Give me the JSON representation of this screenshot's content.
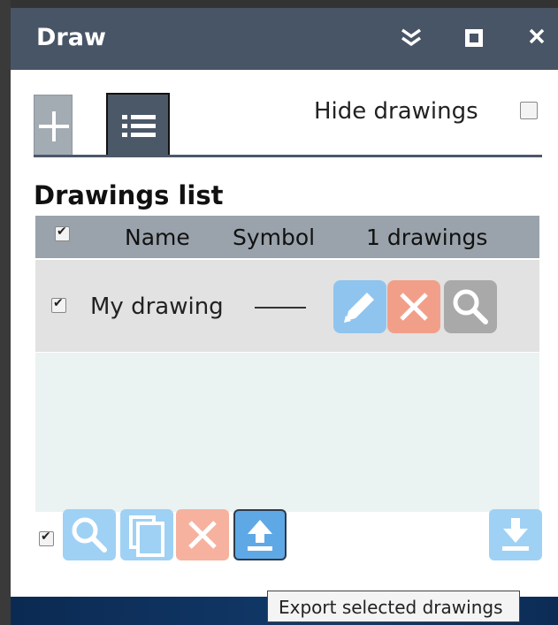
{
  "window": {
    "title": "Draw",
    "controls": {
      "collapse": "collapse-icon",
      "maximize": "maximize-icon",
      "close": "close-icon"
    }
  },
  "tabs": [
    {
      "name": "add-drawing",
      "icon": "plus-icon",
      "active": false
    },
    {
      "name": "drawings-list",
      "icon": "list-icon",
      "active": true
    }
  ],
  "hide_drawings": {
    "label": "Hide drawings",
    "checked": false
  },
  "list": {
    "title": "Drawings list",
    "columns": {
      "name": "Name",
      "symbol": "Symbol",
      "count": "1 drawings"
    },
    "rows": [
      {
        "checked": true,
        "name": "My drawing",
        "symbol": "line"
      }
    ]
  },
  "footer": {
    "select_all_checked": true,
    "buttons": [
      "zoom-icon",
      "copy-icon",
      "delete-icon",
      "export-icon",
      "import-icon"
    ]
  },
  "tooltip": {
    "text": "Export selected drawings"
  },
  "colors": {
    "titlebar": "#485566",
    "edit": "#8fc4ef",
    "delete": "#f29f8a",
    "zoom": "#a9a9a9",
    "export": "#5fa8e6"
  }
}
